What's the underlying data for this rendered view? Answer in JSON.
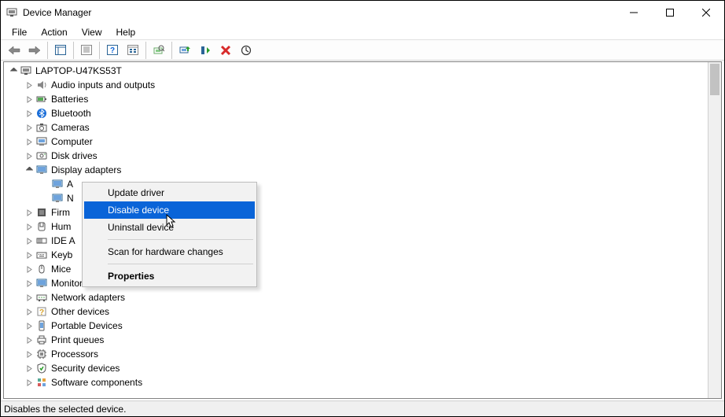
{
  "window": {
    "title": "Device Manager"
  },
  "menu": {
    "file": "File",
    "action": "Action",
    "view": "View",
    "help": "Help"
  },
  "tree": {
    "root": "LAPTOP-U47KS53T",
    "items": [
      "Audio inputs and outputs",
      "Batteries",
      "Bluetooth",
      "Cameras",
      "Computer",
      "Disk drives",
      "Display adapters",
      "A",
      "N",
      "Firm",
      "Hum",
      "IDE A",
      "Keyb",
      "Mice",
      "Monitors",
      "Network adapters",
      "Other devices",
      "Portable Devices",
      "Print queues",
      "Processors",
      "Security devices",
      "Software components"
    ]
  },
  "context_menu": {
    "update": "Update driver",
    "disable": "Disable device",
    "uninstall": "Uninstall device",
    "scan": "Scan for hardware changes",
    "properties": "Properties"
  },
  "status": "Disables the selected device."
}
